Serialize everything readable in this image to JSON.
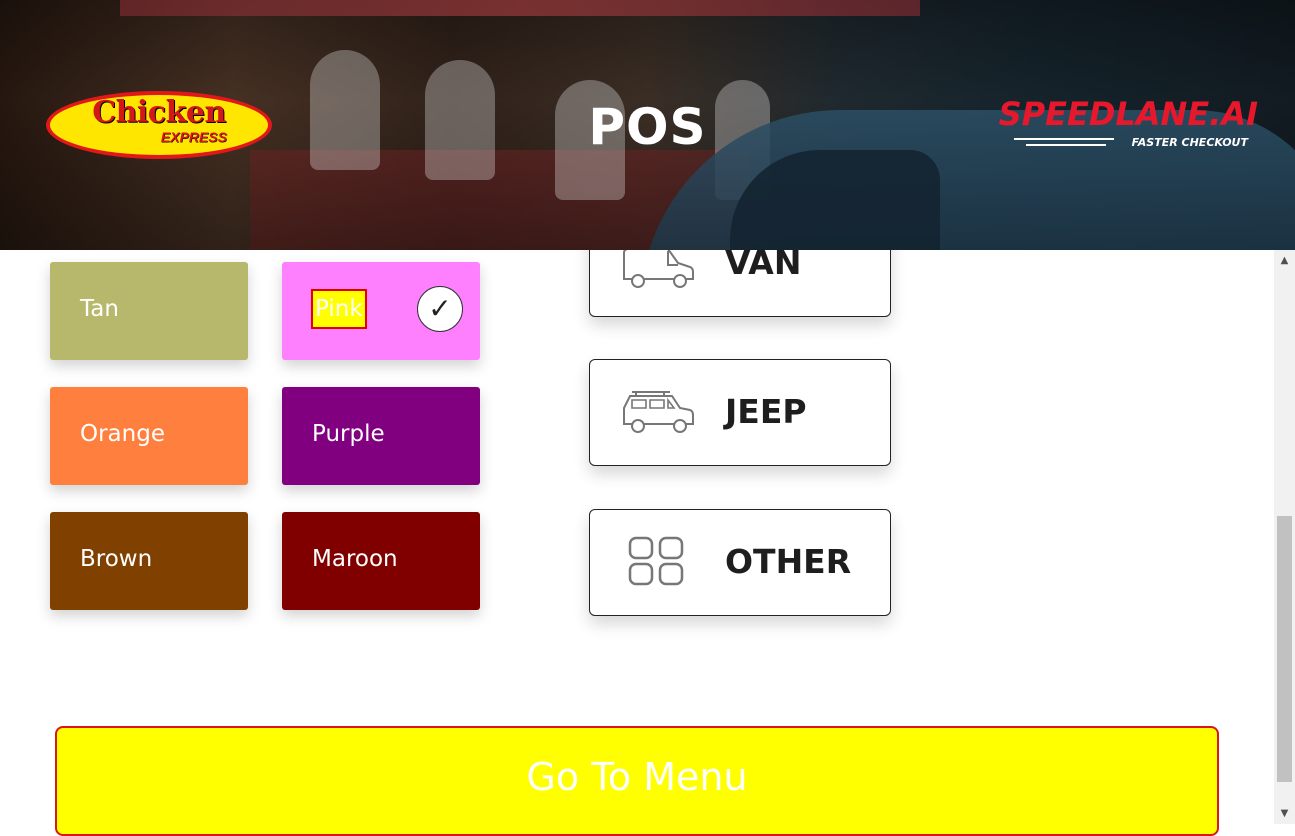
{
  "header": {
    "title": "POS",
    "left_logo": {
      "line1": "Chicken",
      "line2": "EXPRESS"
    },
    "right_logo": {
      "brand": "SPEEDLANE.AI",
      "tagline": "FASTER CHECKOUT"
    }
  },
  "colors": [
    {
      "label": "Tan",
      "color": "#b8b86c",
      "selected": false
    },
    {
      "label": "Pink",
      "color": "#ff80ff",
      "selected": true
    },
    {
      "label": "Orange",
      "color": "#ff7f3f",
      "selected": false
    },
    {
      "label": "Purple",
      "color": "#800080",
      "selected": false
    },
    {
      "label": "Brown",
      "color": "#804000",
      "selected": false
    },
    {
      "label": "Maroon",
      "color": "#800000",
      "selected": false
    }
  ],
  "selected_mark": "✓",
  "vehicles": [
    {
      "label": "VAN",
      "icon": "van-icon"
    },
    {
      "label": "JEEP",
      "icon": "jeep-icon"
    },
    {
      "label": "OTHER",
      "icon": "grid-icon"
    }
  ],
  "go_menu": {
    "label": "Go To Menu"
  },
  "scrollbar": {
    "up": "▲",
    "down": "▼"
  }
}
